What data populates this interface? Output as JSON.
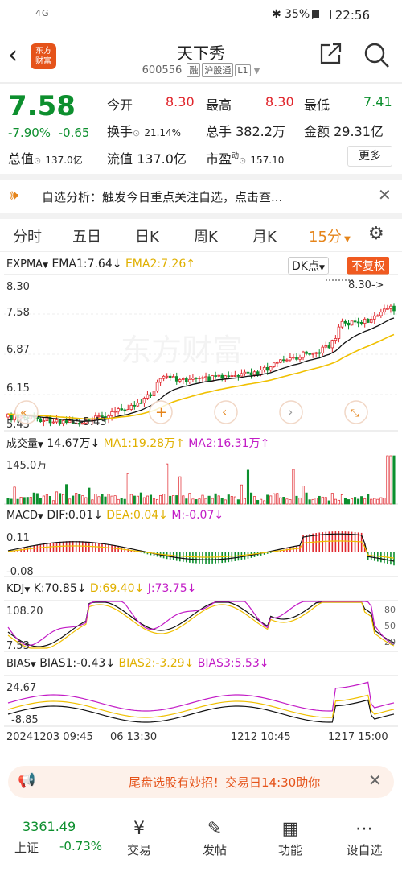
{
  "status": {
    "time": "22:56",
    "battery": "35%",
    "signal": "4G"
  },
  "header": {
    "title": "天下秀",
    "code": "600556",
    "tags": [
      "融",
      "沪股通",
      "L1"
    ]
  },
  "quote": {
    "price": "7.58",
    "change_pct": "-7.90%",
    "change": "-0.65",
    "open_label": "今开",
    "open": "8.30",
    "high_label": "最高",
    "high": "8.30",
    "low_label": "最低",
    "low": "7.41",
    "turnover_label": "换手",
    "turnover": "21.14%",
    "volume_label": "总手",
    "volume": "382.2万",
    "amount_label": "金额",
    "amount": "29.31亿",
    "mktcap_label": "总值",
    "mktcap": "137.0亿",
    "float_label": "流值",
    "float": "137.0亿",
    "pe_label": "市盈",
    "pe_sup": "动",
    "pe": "157.10",
    "more": "更多"
  },
  "banner": {
    "text": "自选分析：触发今日重点关注自选，点击查..."
  },
  "tabs": [
    "分时",
    "五日",
    "日K",
    "周K",
    "月K",
    "15分"
  ],
  "main_chart": {
    "indicator": "EXPMA",
    "ema1": "EMA1:7.64",
    "ema2": "EMA2:7.26",
    "dk": "DK点",
    "adjust": "不复权",
    "watermark": "东方财富",
    "y_labels": [
      "8.30",
      "7.58",
      "6.87",
      "6.15",
      "5.43"
    ],
    "max_label": "8.30->",
    "min_label": "<-5.43"
  },
  "volume_chart": {
    "label": "成交量",
    "v": "14.67万",
    "ma1": "MA1:19.28万",
    "ma2": "MA2:16.31万",
    "y_label": "145.0万"
  },
  "macd_chart": {
    "label": "MACD",
    "dif": "DIF:0.01",
    "dea": "DEA:0.04",
    "m": "M:-0.07",
    "y_top": "0.11",
    "y_bot": "-0.08"
  },
  "kdj_chart": {
    "label": "KDJ",
    "k": "K:70.85",
    "d": "D:69.40",
    "j": "J:73.75",
    "y_top": "108.20",
    "y_bot": "7.53",
    "r_top": "80",
    "r_mid": "50",
    "r_bot": "20"
  },
  "bias_chart": {
    "label": "BIAS",
    "b1": "BIAS1:-0.43",
    "b2": "BIAS2:-3.29",
    "b3": "BIAS3:5.53",
    "y_top": "24.67",
    "y_bot": "-8.85"
  },
  "x_labels": [
    "20241203 09:45",
    "06 13:30",
    "1212 10:45",
    "1217 15:00"
  ],
  "bottom_banner": {
    "text": "尾盘选股有妙招！交易日14:30助你"
  },
  "index": {
    "value": "3361.49",
    "name": "上证",
    "change": "-0.73%"
  },
  "nav": [
    "交易",
    "发帖",
    "功能",
    "设自选"
  ],
  "colors": {
    "up": "#e0262c",
    "down": "#0d8f2e",
    "accent": "#e5841a",
    "ema1": "#111111",
    "ema2": "#f0c000",
    "purple": "#c21bc6"
  }
}
